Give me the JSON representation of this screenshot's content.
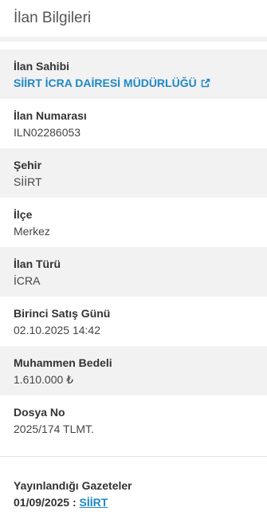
{
  "panel": {
    "title": "İlan Bilgileri"
  },
  "fields": {
    "owner": {
      "label": "İlan Sahibi",
      "value": "SİİRT İCRA DAİRESİ MÜDÜRLÜĞÜ",
      "icon": "external-link-icon"
    },
    "number": {
      "label": "İlan Numarası",
      "value": "ILN02286053"
    },
    "city": {
      "label": "Şehir",
      "value": "SİİRT"
    },
    "district": {
      "label": "İlçe",
      "value": "Merkez"
    },
    "type": {
      "label": "İlan Türü",
      "value": "İCRA"
    },
    "first_sale": {
      "label": "Birinci Satış Günü",
      "value": "02.10.2025 14:42"
    },
    "estimated_value": {
      "label": "Muhammen Bedeli",
      "value": "1.610.000 ₺"
    },
    "file_no": {
      "label": "Dosya No",
      "value": "2025/174 TLMT."
    }
  },
  "gazettes": {
    "title": "Yayınlandığı Gazeteler",
    "entries": [
      {
        "date": "01/09/2025 :",
        "name": "SİİRT"
      }
    ]
  },
  "colors": {
    "link": "#1e88c6",
    "shaded_row": "#f2f2f2"
  }
}
